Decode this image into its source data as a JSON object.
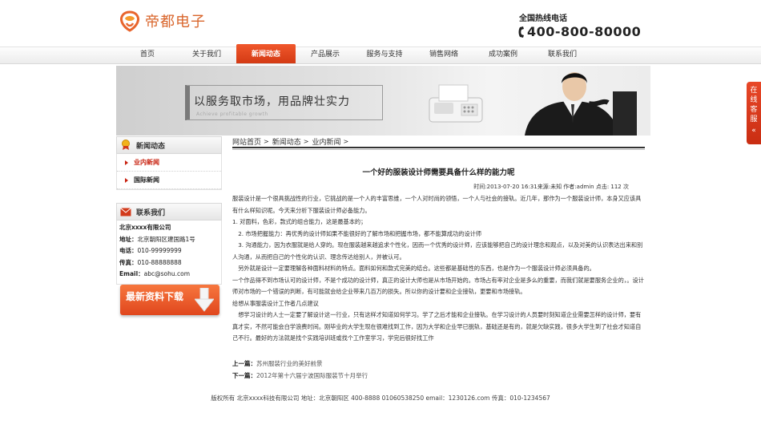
{
  "brand": {
    "name": "帝都电子"
  },
  "hotline": {
    "label": "全国热线电话",
    "number": "400-800-80000"
  },
  "nav": {
    "items": [
      {
        "label": "首页"
      },
      {
        "label": "关于我们"
      },
      {
        "label": "新闻动态",
        "active": true
      },
      {
        "label": "产品展示"
      },
      {
        "label": "服务与支持"
      },
      {
        "label": "销售网络"
      },
      {
        "label": "成功案例"
      },
      {
        "label": "联系我们"
      }
    ]
  },
  "banner": {
    "slogan": "以服务取市场，用品牌壮实力",
    "sub": "Achieve profitable growth"
  },
  "service": {
    "label": [
      "在",
      "线",
      "客",
      "服"
    ],
    "close": "«"
  },
  "sidebar": {
    "news_title": "新闻动态",
    "news_items": [
      {
        "label": "业内新闻"
      },
      {
        "label": "国际新闻"
      }
    ],
    "contact_title": "联系我们",
    "contact": {
      "company": "北京xxxx有限公司",
      "address_label": "地址：",
      "address": "北京朝阳区建国路1号",
      "phone_label": "电话：",
      "phone": "010-99999999",
      "fax_label": "传真：",
      "fax": "010-88888888",
      "email_label": "Email：",
      "email": "abc@sohu.com"
    },
    "download_label": "最新资料下载"
  },
  "breadcrumb": {
    "items": [
      "网站首页",
      "新闻动态",
      "业内新闻"
    ]
  },
  "article": {
    "title": "一个好的服装设计师需要具备什么样的能力呢",
    "meta": "时间:2013-07-20 16:31来源:未知 作者:admin 点击: 112 次",
    "paragraphs": [
      "服装设计是一个很具挑战性的行业，它挑战的是一个人的丰富思维，一个人对时尚的领悟，一个人与社会的接轨。近几年，那作为一个服装设计师，本身又应该具有什么样知识呢。今天来分析下服装设计师必备能力。",
      "1. 对面料，色彩，款式的组合能力，这是最基本的；",
      "　2. 市场把握能力：再优秀的设计师如果不能很好的了解市场和把握市场，都不能算成功的设计师",
      "　3. 沟通能力，因为衣服就是给人穿的。现在服装越来越追求个性化，因而一个优秀的设计师，应该能够把自己的设计理念和观点，以及对美的认识表达出来和别人沟通，从而把自己的个性化的认识、理念传达给别人，并被认可。",
      "　另外就是设计一定要理解各种面料材料的特点。面料如何和款式完美的结合。这些都是基础性的东西，也是作为一个服装设计师必须具备的。",
      "一个作品得不到市场认可的设计师，不是个成功的设计师，真正的设计大师也是从市场开始的。市场占有率对企业是多么的重要，而我们就是要服务企业的，。设计师对市场的一个错误的判断，有可能就会给企业带来几百万的损失。所以你的设计要和企业接轨，更要和市场接轨。",
      "给想从事服装设计工作者几点建议",
      "　想学习设计的人士一定要了解设计这一行业，只有这样才知道如何学习。学了之后才能和企业接轨。在学习设计的人员要时刻知道企业需要怎样的设计师，要有真才实，不然可能会白学浪费时间。刚毕业的大学生现在很难找到工作，因为大学和企业早已脱轨，基础还是有的，就是欠缺实践，很多大学生到了社会才知道自己不行。最好的方法就是找个实践培训班或找个工作室学习，学完后很好找工作"
    ],
    "prev_label": "上一篇：",
    "prev": "苏州服装行业的美好前景",
    "next_label": "下一篇：",
    "next": "2012年第十六届宁波国际服装节十月举行"
  },
  "footer": {
    "text": "版权所有 北京xxxx科技有限公司 地址：北京朝阳区 400-8888 01060538250 email：1230126.com 传真：010-1234567"
  },
  "colors": {
    "accent": "#e0461d",
    "link_red": "#c8200e"
  }
}
